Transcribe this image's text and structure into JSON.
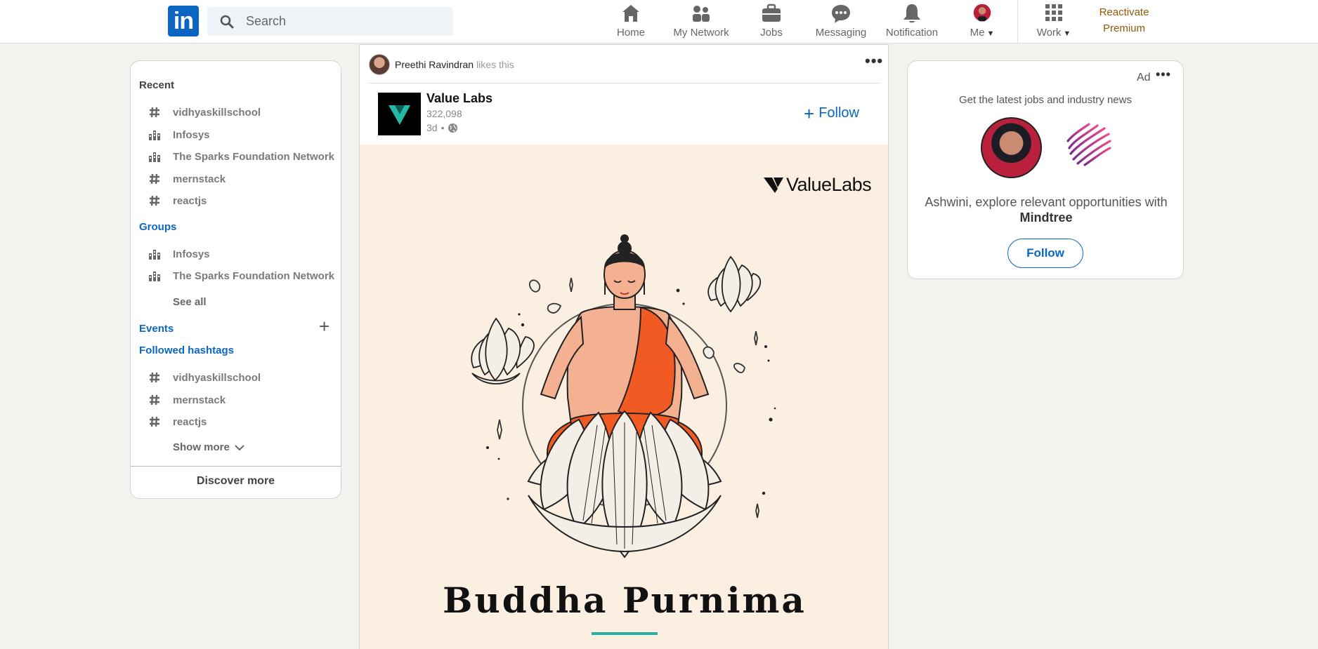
{
  "nav": {
    "search_placeholder": "Search",
    "items": [
      {
        "label": "Home",
        "icon": "home-icon"
      },
      {
        "label": "My Network",
        "icon": "network-icon"
      },
      {
        "label": "Jobs",
        "icon": "briefcase-icon"
      },
      {
        "label": "Messaging",
        "icon": "chat-icon"
      },
      {
        "label": "Notification",
        "icon": "bell-icon"
      },
      {
        "label": "Me",
        "icon": "avatar"
      },
      {
        "label": "Work",
        "icon": "grid-icon"
      }
    ],
    "premium_line1": "Reactivate",
    "premium_line2": "Premium",
    "premium_color": "#915907"
  },
  "sidebar": {
    "recent_title": "Recent",
    "recent": [
      {
        "label": "vidhyaskillschool",
        "icon": "hashtag-icon"
      },
      {
        "label": "Infosys",
        "icon": "group-icon"
      },
      {
        "label": "The Sparks Foundation Network",
        "icon": "group-icon"
      },
      {
        "label": "mernstack",
        "icon": "hashtag-icon"
      },
      {
        "label": "reactjs",
        "icon": "hashtag-icon"
      }
    ],
    "groups_title": "Groups",
    "groups": [
      {
        "label": "Infosys",
        "icon": "group-icon"
      },
      {
        "label": "The Sparks Foundation Network",
        "icon": "group-icon"
      }
    ],
    "see_all": "See all",
    "events_title": "Events",
    "hashtags_title": "Followed hashtags",
    "hashtags": [
      {
        "label": "vidhyaskillschool",
        "icon": "hashtag-icon"
      },
      {
        "label": "mernstack",
        "icon": "hashtag-icon"
      },
      {
        "label": "reactjs",
        "icon": "hashtag-icon"
      }
    ],
    "show_more": "Show more",
    "discover_more": "Discover more"
  },
  "post": {
    "liker": "Preethi Ravindran",
    "like_text": "likes this",
    "company": "Value Labs",
    "followers": "322,098",
    "time": "3d",
    "follow_label": "Follow",
    "image_brand": "ValueLabs",
    "image_title": "Buddha Purnima",
    "accent_color": "#2ab1a5"
  },
  "ad": {
    "label": "Ad",
    "headline": "Get the latest jobs and industry news",
    "text_prefix": "Ashwini, explore relevant opportunities with",
    "company": "Mindtree",
    "follow_label": "Follow"
  },
  "colors": {
    "brand_blue": "#0a66c2",
    "page_bg": "#f3f2ef"
  }
}
